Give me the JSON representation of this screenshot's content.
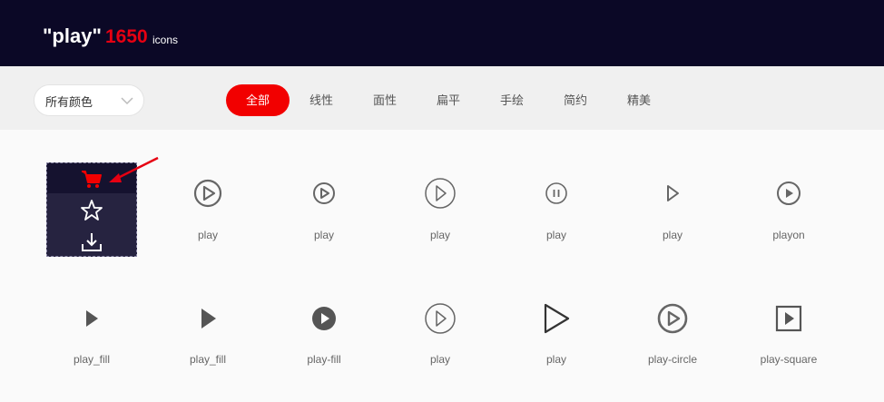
{
  "header": {
    "query": "\"play\"",
    "count": "1650",
    "unit": "icons"
  },
  "filter": {
    "color_select": "所有颜色",
    "tabs": [
      "全部",
      "线性",
      "面性",
      "扁平",
      "手绘",
      "简约",
      "精美"
    ],
    "active_tab": 0
  },
  "icons_row1": [
    {
      "name": "play",
      "icon": "play-circle-outline-icon"
    },
    {
      "name": "play",
      "icon": "play-circle-small-icon"
    },
    {
      "name": "play",
      "icon": "play-circle-thin-icon"
    },
    {
      "name": "play",
      "icon": "pause-circle-icon"
    },
    {
      "name": "play",
      "icon": "play-triangle-outline-icon"
    },
    {
      "name": "playon",
      "icon": "play-circle-outline-icon"
    }
  ],
  "icons_row2": [
    {
      "name": "play_fill",
      "icon": "play-triangle-fill-icon"
    },
    {
      "name": "play_fill",
      "icon": "play-triangle-fill-icon"
    },
    {
      "name": "play-fill",
      "icon": "play-circle-fill-icon"
    },
    {
      "name": "play",
      "icon": "play-circle-thin-icon"
    },
    {
      "name": "play",
      "icon": "play-triangle-large-icon"
    },
    {
      "name": "play-circle",
      "icon": "play-circle-outline-icon"
    },
    {
      "name": "play-square",
      "icon": "play-square-icon"
    }
  ],
  "hover_actions": {
    "cart_icon": "cart-icon",
    "star_icon": "star-icon",
    "download_icon": "download-icon"
  },
  "colors": {
    "accent": "#f20000",
    "header_bg": "#0b0826",
    "icon": "#666666"
  }
}
